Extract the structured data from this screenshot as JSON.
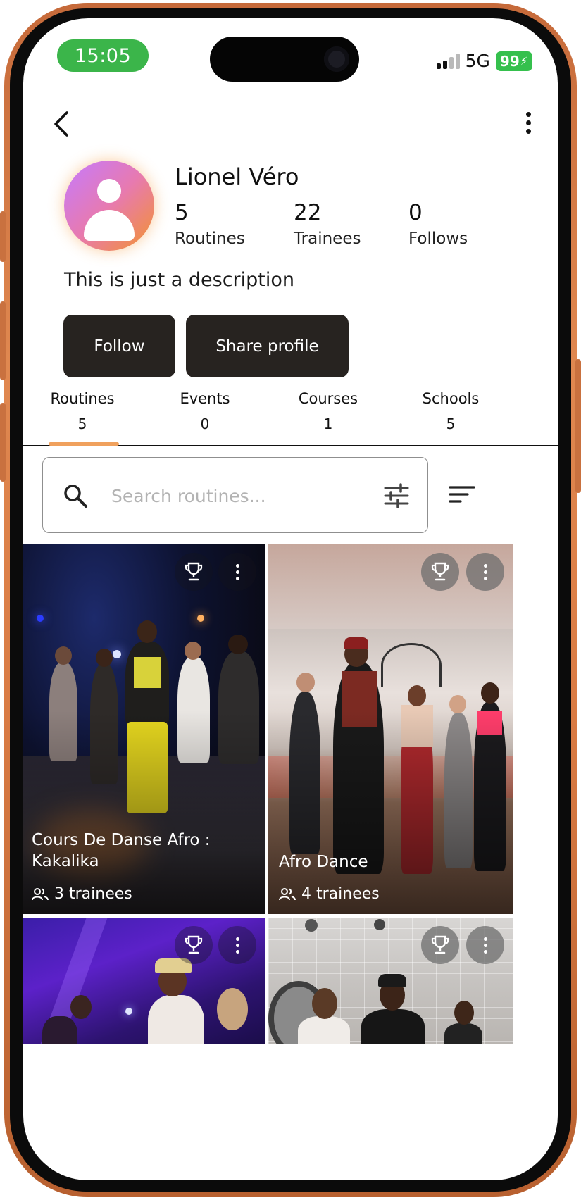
{
  "status_bar": {
    "time": "15:05",
    "network": "5G",
    "battery": "99"
  },
  "profile": {
    "name": "Lionel Véro",
    "stats": [
      {
        "value": "5",
        "label": "Routines"
      },
      {
        "value": "22",
        "label": "Trainees"
      },
      {
        "value": "0",
        "label": "Follows"
      }
    ],
    "description": "This is just a description",
    "follow_label": "Follow",
    "share_label": "Share profile"
  },
  "tabs": [
    {
      "label": "Routines",
      "count": "5",
      "active": true
    },
    {
      "label": "Events",
      "count": "0"
    },
    {
      "label": "Courses",
      "count": "1"
    },
    {
      "label": "Schools",
      "count": "5"
    }
  ],
  "search": {
    "placeholder": "Search routines...",
    "value": ""
  },
  "routines": [
    {
      "title": "Cours De Danse Afro : Kakalika",
      "trainees": "3 trainees"
    },
    {
      "title": "Afro Dance",
      "trainees": "4 trainees"
    },
    {
      "title": "",
      "trainees": ""
    },
    {
      "title": "",
      "trainees": ""
    }
  ],
  "colors": {
    "accent": "#f0a15d",
    "button_bg": "#272320",
    "time_pill": "#3bb54a",
    "frame": "#d97b44"
  },
  "icons": [
    "back-arrow-icon",
    "more-vertical-icon",
    "search-icon",
    "tune-icon",
    "sort-icon",
    "trophy-icon",
    "people-icon"
  ]
}
